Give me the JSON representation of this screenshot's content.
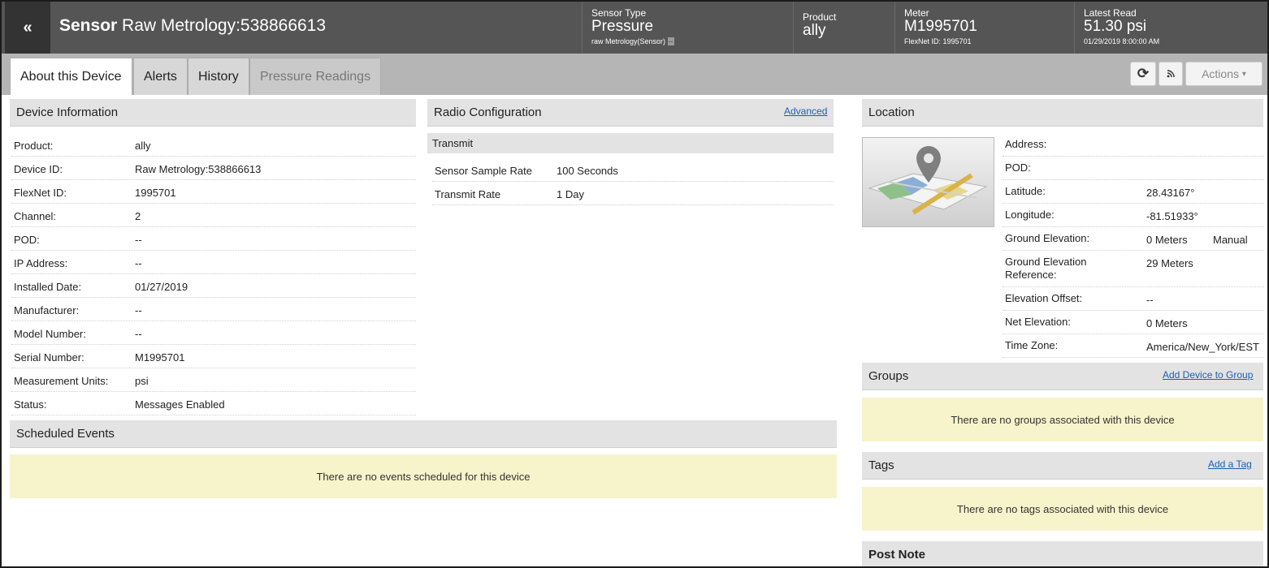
{
  "header": {
    "back_icon": "«",
    "title_bold": "Sensor",
    "title_rest": " Raw Metrology:538866613",
    "sensor_type": {
      "label": "Sensor Type",
      "value": "Pressure",
      "sub": "raw Metrology(Sensor)",
      "sub_badge": "--"
    },
    "product": {
      "label": "Product",
      "value": "ally"
    },
    "meter": {
      "label": "Meter",
      "value": "M1995701",
      "sub": "FlexNet ID: 1995701"
    },
    "latest_read": {
      "label": "Latest Read",
      "value": "51.30 psi",
      "sub": "01/29/2019 8:00:00 AM"
    }
  },
  "tabs": [
    "About this Device",
    "Alerts",
    "History",
    "Pressure Readings"
  ],
  "toolbar": {
    "refresh_icon": "⟳",
    "rss_icon": "rss",
    "actions_label": "Actions",
    "actions_caret": "▾"
  },
  "device_info": {
    "title": "Device Information",
    "rows": [
      {
        "k": "Product:",
        "v": "ally"
      },
      {
        "k": "Device ID:",
        "v": "Raw Metrology:538866613"
      },
      {
        "k": "FlexNet ID:",
        "v": "1995701"
      },
      {
        "k": "Channel:",
        "v": "2"
      },
      {
        "k": "POD:",
        "v": "--"
      },
      {
        "k": "IP Address:",
        "v": "--"
      },
      {
        "k": "Installed Date:",
        "v": "01/27/2019"
      },
      {
        "k": "Manufacturer:",
        "v": "--"
      },
      {
        "k": "Model Number:",
        "v": "--"
      },
      {
        "k": "Serial Number:",
        "v": "M1995701"
      },
      {
        "k": "Measurement Units:",
        "v": "psi"
      },
      {
        "k": "Status:",
        "v": "Messages Enabled"
      }
    ]
  },
  "radio": {
    "title": "Radio Configuration",
    "advanced_link": "Advanced",
    "transmit_label": "Transmit",
    "rows": [
      {
        "k": "Sensor Sample Rate",
        "v": "100 Seconds"
      },
      {
        "k": "Transmit Rate",
        "v": "1 Day"
      }
    ]
  },
  "scheduled": {
    "title": "Scheduled Events",
    "empty": "There are no events scheduled for this device"
  },
  "location": {
    "title": "Location",
    "rows": [
      {
        "k": "Address:",
        "v": ""
      },
      {
        "k": "POD:",
        "v": ""
      },
      {
        "k": "Latitude:",
        "v": "28.43167°"
      },
      {
        "k": "Longitude:",
        "v": "-81.51933°"
      },
      {
        "k": "Ground Elevation:",
        "v": "0 Meters",
        "extra": "Manual"
      },
      {
        "k": "Ground Elevation Reference:",
        "v": "29 Meters"
      },
      {
        "k": "Elevation Offset:",
        "v": "--"
      },
      {
        "k": "Net Elevation:",
        "v": "0 Meters"
      },
      {
        "k": "Time Zone:",
        "v": "America/New_York/EST"
      }
    ]
  },
  "groups": {
    "title": "Groups",
    "link": "Add Device to Group",
    "empty": "There are no groups associated with this device"
  },
  "tags": {
    "title": "Tags",
    "link": "Add a Tag",
    "empty": "There are no tags associated with this device"
  },
  "post_note": {
    "title": "Post Note"
  },
  "colors": {
    "header_bg": "#555555",
    "panel_head": "#e3e3e3",
    "empty_bg": "#f7f4cb",
    "link": "#1a5fb4"
  }
}
